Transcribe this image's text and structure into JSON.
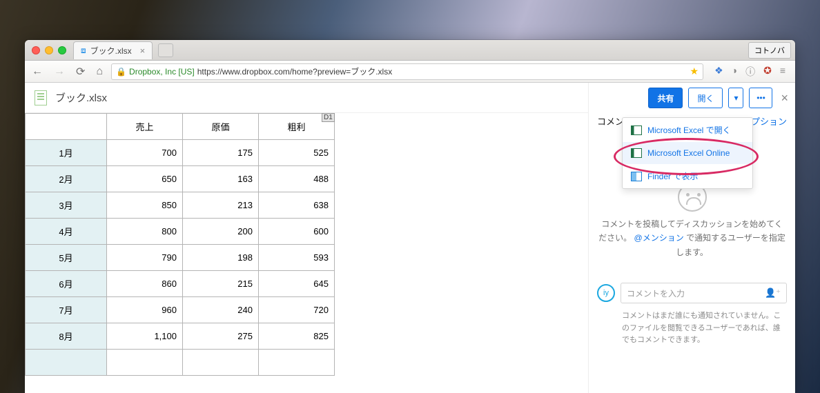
{
  "browser": {
    "tab_title": "ブック.xlsx",
    "right_button": "コトノバ",
    "ev_label": "Dropbox, Inc [US]",
    "url": "https://www.dropbox.com/home?preview=ブック.xlsx"
  },
  "file": {
    "name": "ブック.xlsx",
    "cell_ref": "D1",
    "columns": [
      "売上",
      "原価",
      "粗利"
    ],
    "rows": [
      {
        "label": "1月",
        "cells": [
          "700",
          "175",
          "525"
        ]
      },
      {
        "label": "2月",
        "cells": [
          "650",
          "163",
          "488"
        ]
      },
      {
        "label": "3月",
        "cells": [
          "850",
          "213",
          "638"
        ]
      },
      {
        "label": "4月",
        "cells": [
          "800",
          "200",
          "600"
        ]
      },
      {
        "label": "5月",
        "cells": [
          "790",
          "198",
          "593"
        ]
      },
      {
        "label": "6月",
        "cells": [
          "860",
          "215",
          "645"
        ]
      },
      {
        "label": "7月",
        "cells": [
          "960",
          "240",
          "720"
        ]
      },
      {
        "label": "8月",
        "cells": [
          "1,100",
          "275",
          "825"
        ]
      }
    ]
  },
  "side": {
    "share": "共有",
    "open": "開く",
    "tab_comments": "コメント",
    "tab_options": "プション",
    "dropdown": {
      "item0": "Microsoft Excel で開く",
      "item1": "Microsoft Excel Online",
      "item2": "Finder で表示"
    },
    "empty1": "コメントを投稿してディスカッションを始めてください。",
    "mention": "@メンション",
    "empty2": "で通知するユーザーを指定します。",
    "avatar": "iy",
    "input_placeholder": "コメントを入力",
    "note": "コメントはまだ誰にも通知されていません。このファイルを閲覧できるユーザーであれば、誰でもコメントできます。"
  }
}
